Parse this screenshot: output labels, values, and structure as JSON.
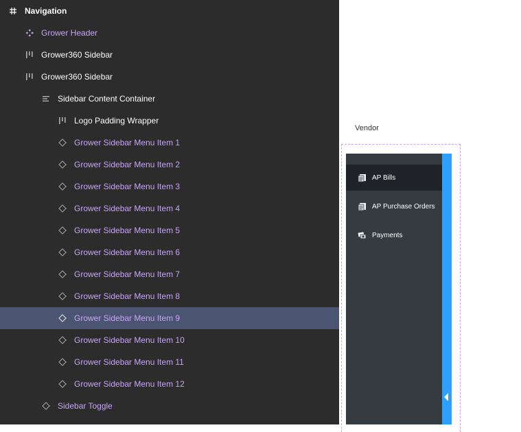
{
  "layers": {
    "rows": [
      {
        "label": "Navigation",
        "icon": "frame-hash-icon"
      },
      {
        "label": "Grower Header",
        "icon": "component-instance-icon"
      },
      {
        "label": "Grower360 Sidebar",
        "icon": "auto-layout-horizontal-icon"
      },
      {
        "label": "Grower360 Sidebar",
        "icon": "auto-layout-horizontal-icon"
      },
      {
        "label": "Sidebar Content Container",
        "icon": "auto-layout-vertical-icon"
      },
      {
        "label": "Logo Padding Wrapper",
        "icon": "auto-layout-horizontal-icon"
      },
      {
        "label": "Grower Sidebar Menu Item 1",
        "icon": "instance-diamond-icon"
      },
      {
        "label": "Grower Sidebar Menu Item 2",
        "icon": "instance-diamond-icon"
      },
      {
        "label": "Grower Sidebar Menu Item 3",
        "icon": "instance-diamond-icon"
      },
      {
        "label": "Grower Sidebar Menu Item 4",
        "icon": "instance-diamond-icon"
      },
      {
        "label": "Grower Sidebar Menu Item 5",
        "icon": "instance-diamond-icon"
      },
      {
        "label": "Grower Sidebar Menu Item 6",
        "icon": "instance-diamond-icon"
      },
      {
        "label": "Grower Sidebar Menu Item 7",
        "icon": "instance-diamond-icon"
      },
      {
        "label": "Grower Sidebar Menu Item 8",
        "icon": "instance-diamond-icon"
      },
      {
        "label": "Grower Sidebar Menu Item 9",
        "icon": "instance-diamond-icon",
        "selected": true
      },
      {
        "label": "Grower Sidebar Menu Item 10",
        "icon": "instance-diamond-icon"
      },
      {
        "label": "Grower Sidebar Menu Item 11",
        "icon": "instance-diamond-icon"
      },
      {
        "label": "Grower Sidebar Menu Item 12",
        "icon": "instance-diamond-icon"
      },
      {
        "label": "Sidebar Toggle",
        "icon": "instance-diamond-icon"
      }
    ]
  },
  "canvas": {
    "frame_label": "Vendor",
    "menu": [
      {
        "label": "AP Bills",
        "icon": "bills-icon",
        "active": true
      },
      {
        "label": "AP Purchase Orders",
        "icon": "purchase-orders-icon"
      },
      {
        "label": "Payments",
        "icon": "payments-icon"
      }
    ],
    "toggle_icon": "collapse-left-arrow-icon"
  },
  "colors": {
    "panel_bg": "#2c2c2c",
    "selected_row": "#4b5470",
    "component_purple": "#c7a4f5",
    "sidebar_bg": "#363b40",
    "sidebar_active": "#1f2226",
    "toggle_blue": "#2d9ffc",
    "frame_dash": "#c9a3e8"
  }
}
